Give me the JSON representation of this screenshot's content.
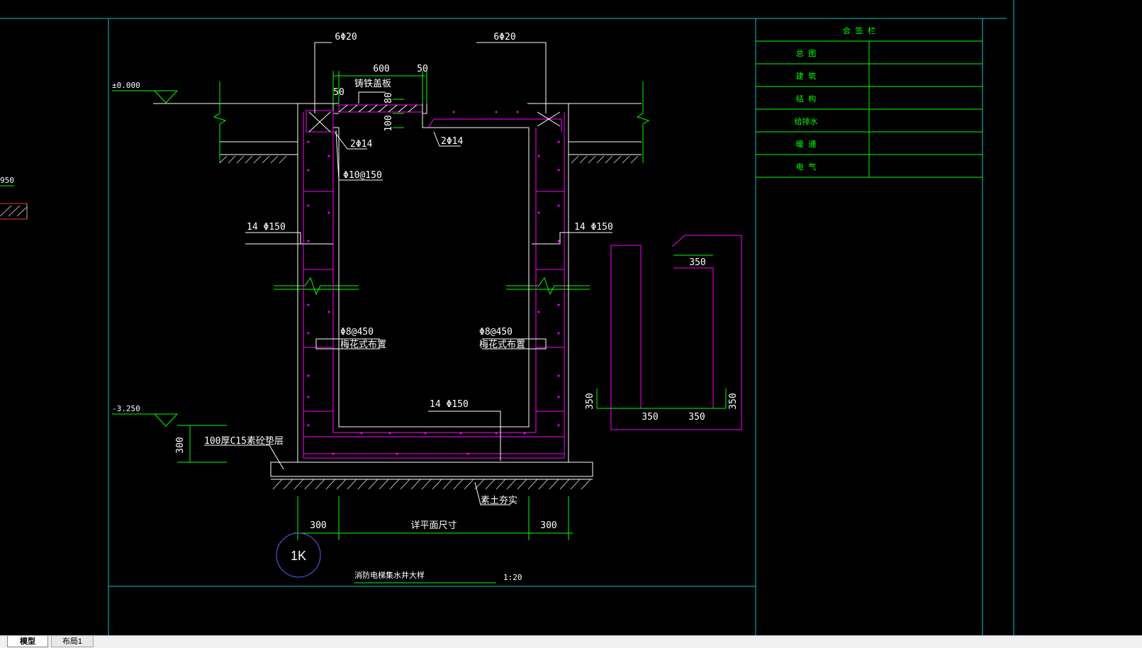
{
  "tabs": [
    {
      "label": "模型",
      "active": true
    },
    {
      "label": "布局1",
      "active": false
    }
  ],
  "title_block": {
    "header": "会 签 栏",
    "rows": [
      "总 图",
      "建 筑",
      "结 构",
      "给排水",
      "暖 通",
      "电 气"
    ]
  },
  "left_labels": {
    "elev": "950"
  },
  "detail": {
    "top_rebar_left": "6Φ20",
    "top_rebar_right": "6Φ20",
    "dim_600": "600",
    "dim_50_top": "50",
    "dim_50_left": "50",
    "cover_label": "铸铁盖板",
    "dim_80": "80",
    "dim_100": "100",
    "rebar_2phi14_left": "2Φ14",
    "rebar_2phi14_right": "2Φ14",
    "rebar_phi10": "Φ10@150",
    "rebar_14phi150_left": "14 Φ150",
    "rebar_14phi150_right": "14 Φ150",
    "tie_left_1": "Φ8@450",
    "tie_left_2": "梅花式布置",
    "tie_right_1": "Φ8@450",
    "tie_right_2": "梅花式布置",
    "rebar_bottom": "14 Φ150",
    "elev_top": "±0.000",
    "elev_bottom": "-3.250",
    "dim_300_v": "300",
    "cushion": "100厚C15素砼垫层",
    "soil": "素土夯实",
    "dim_300_l": "300",
    "dim_300_r": "300",
    "plan_size": "详平面尺寸",
    "marker": "1K",
    "title": "消防电梯集水井大样",
    "scale": "1:20"
  },
  "bar_shape": {
    "top": "350",
    "left": "350",
    "bottom_1": "350",
    "bottom_2": "350",
    "right": "350"
  },
  "colors": {
    "background": "#000000",
    "frame": "#00c8c8",
    "white": "#ffffff",
    "green": "#00ff00",
    "magenta": "#ff00ff",
    "grey": "#b0b0b0",
    "red": "#ff3030",
    "blue": "#6060ff"
  }
}
